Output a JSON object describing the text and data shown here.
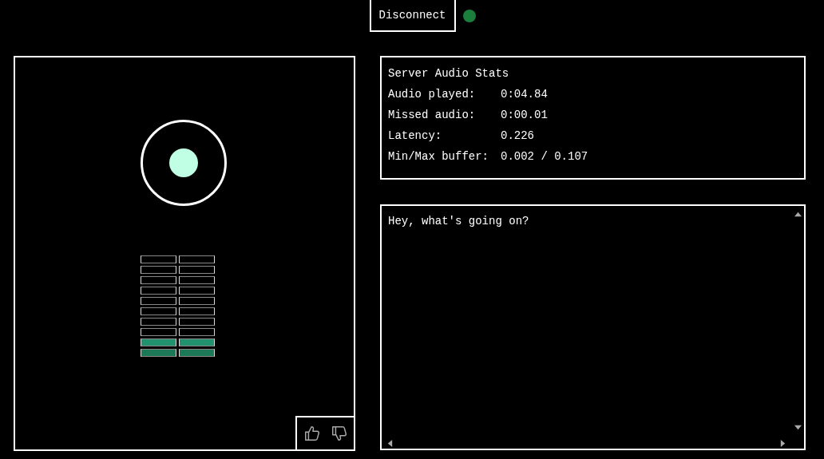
{
  "connection": {
    "button": "Disconnect",
    "connected": true
  },
  "visualizer": {
    "active": true,
    "meters": [
      {
        "segments": [
          {
            "lit": false
          },
          {
            "lit": false
          },
          {
            "lit": false
          },
          {
            "lit": false
          },
          {
            "lit": false
          },
          {
            "lit": false
          },
          {
            "lit": false
          },
          {
            "lit": false
          },
          {
            "lit": true
          },
          {
            "lit": true
          }
        ]
      },
      {
        "segments": [
          {
            "lit": false
          },
          {
            "lit": false
          },
          {
            "lit": false
          },
          {
            "lit": false
          },
          {
            "lit": false
          },
          {
            "lit": false
          },
          {
            "lit": false
          },
          {
            "lit": false
          },
          {
            "lit": true
          },
          {
            "lit": true
          }
        ]
      }
    ]
  },
  "stats": {
    "title": "Server Audio Stats",
    "rows": [
      {
        "label": "Audio played:",
        "value": "0:04.84"
      },
      {
        "label": "Missed audio:",
        "value": "0:00.01"
      },
      {
        "label": "Latency:",
        "value": "0.226"
      },
      {
        "label": "Min/Max buffer:",
        "value": "0.002 / 0.107"
      }
    ]
  },
  "message": {
    "value": "Hey, what's going on?"
  }
}
